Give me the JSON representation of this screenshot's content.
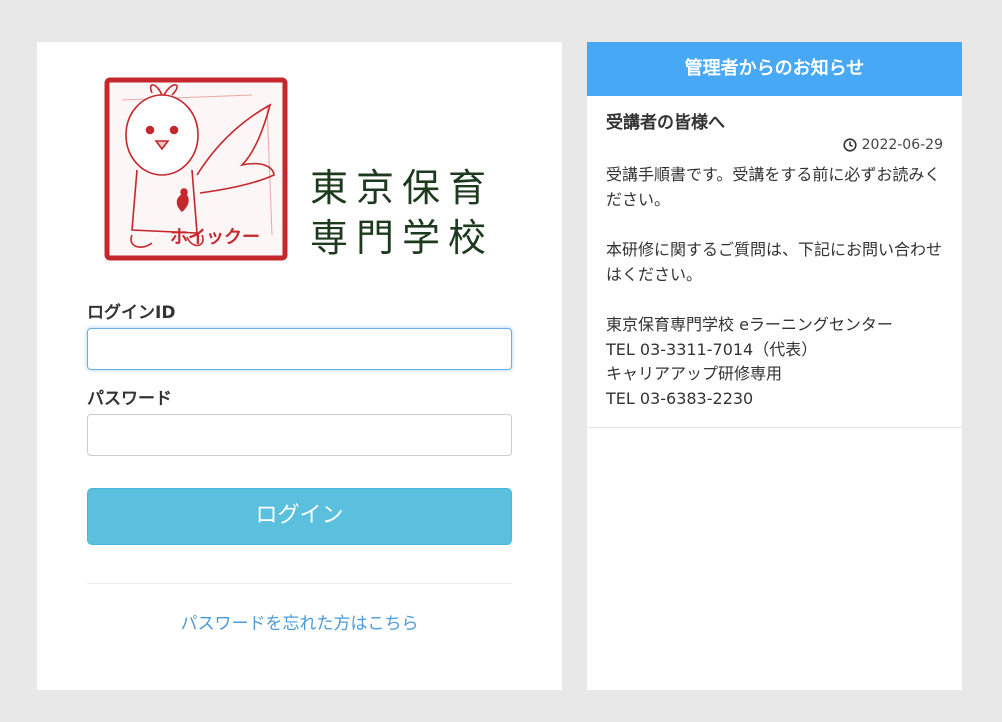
{
  "login": {
    "logo_text_line1": "東京保育",
    "logo_text_line2": "専門学校",
    "logo_mascot_text": "ホイックー",
    "id_label": "ログインID",
    "id_value": "",
    "password_label": "パスワード",
    "password_value": "",
    "login_button": "ログイン",
    "forgot_link": "パスワードを忘れた方はこちら"
  },
  "notice": {
    "header": "管理者からのお知らせ",
    "title": "受講者の皆様へ",
    "date": "2022-06-29",
    "paragraph1": "受講手順書です。受講をする前に必ずお読みください。",
    "paragraph2": "本研修に関するご質問は、下記にお問い合わせはください。",
    "contact_line1": "東京保育専門学校 eラーニングセンター",
    "contact_line2": "TEL 03-3311-7014（代表）",
    "contact_line3": "キャリアアップ研修専用",
    "contact_line4": "TEL 03-6383-2230"
  },
  "colors": {
    "background": "#e8e8e8",
    "notice_header": "#47a8f5",
    "login_button": "#5bc0de",
    "link": "#4a9bd8",
    "seal_red": "#c4282c"
  }
}
